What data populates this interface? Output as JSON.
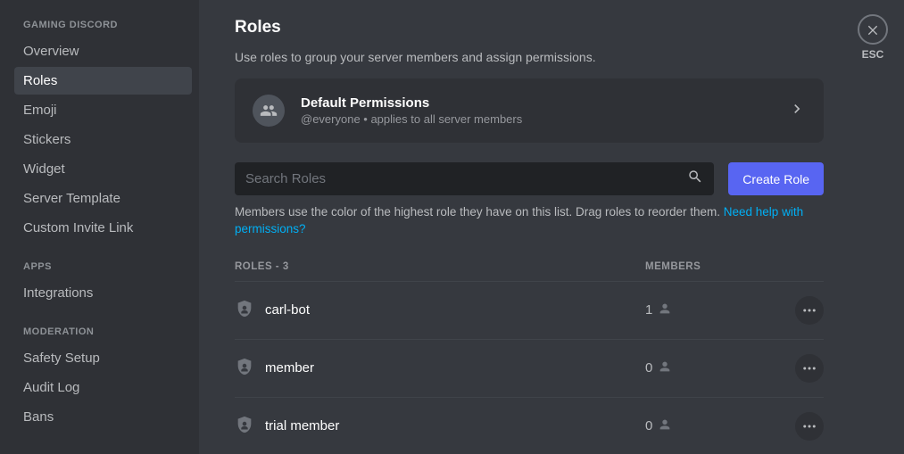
{
  "sidebar": {
    "sections": [
      {
        "header": "GAMING DISCORD",
        "items": [
          {
            "label": "Overview",
            "active": false
          },
          {
            "label": "Roles",
            "active": true
          },
          {
            "label": "Emoji",
            "active": false
          },
          {
            "label": "Stickers",
            "active": false
          },
          {
            "label": "Widget",
            "active": false
          },
          {
            "label": "Server Template",
            "active": false
          },
          {
            "label": "Custom Invite Link",
            "active": false
          }
        ]
      },
      {
        "header": "APPS",
        "items": [
          {
            "label": "Integrations",
            "active": false
          }
        ]
      },
      {
        "header": "MODERATION",
        "items": [
          {
            "label": "Safety Setup",
            "active": false
          },
          {
            "label": "Audit Log",
            "active": false
          },
          {
            "label": "Bans",
            "active": false
          }
        ]
      }
    ]
  },
  "close_label": "ESC",
  "page": {
    "title": "Roles",
    "description": "Use roles to group your server members and assign permissions."
  },
  "default_perms": {
    "title": "Default Permissions",
    "subtitle": "@everyone • applies to all server members"
  },
  "search": {
    "placeholder": "Search Roles"
  },
  "create_button": "Create Role",
  "help": {
    "text": "Members use the color of the highest role they have on this list. Drag roles to reorder them. ",
    "link": "Need help with permissions?"
  },
  "table": {
    "roles_header": "ROLES - 3",
    "members_header": "MEMBERS",
    "rows": [
      {
        "name": "carl-bot",
        "members": "1"
      },
      {
        "name": "member",
        "members": "0"
      },
      {
        "name": "trial member",
        "members": "0"
      }
    ]
  }
}
